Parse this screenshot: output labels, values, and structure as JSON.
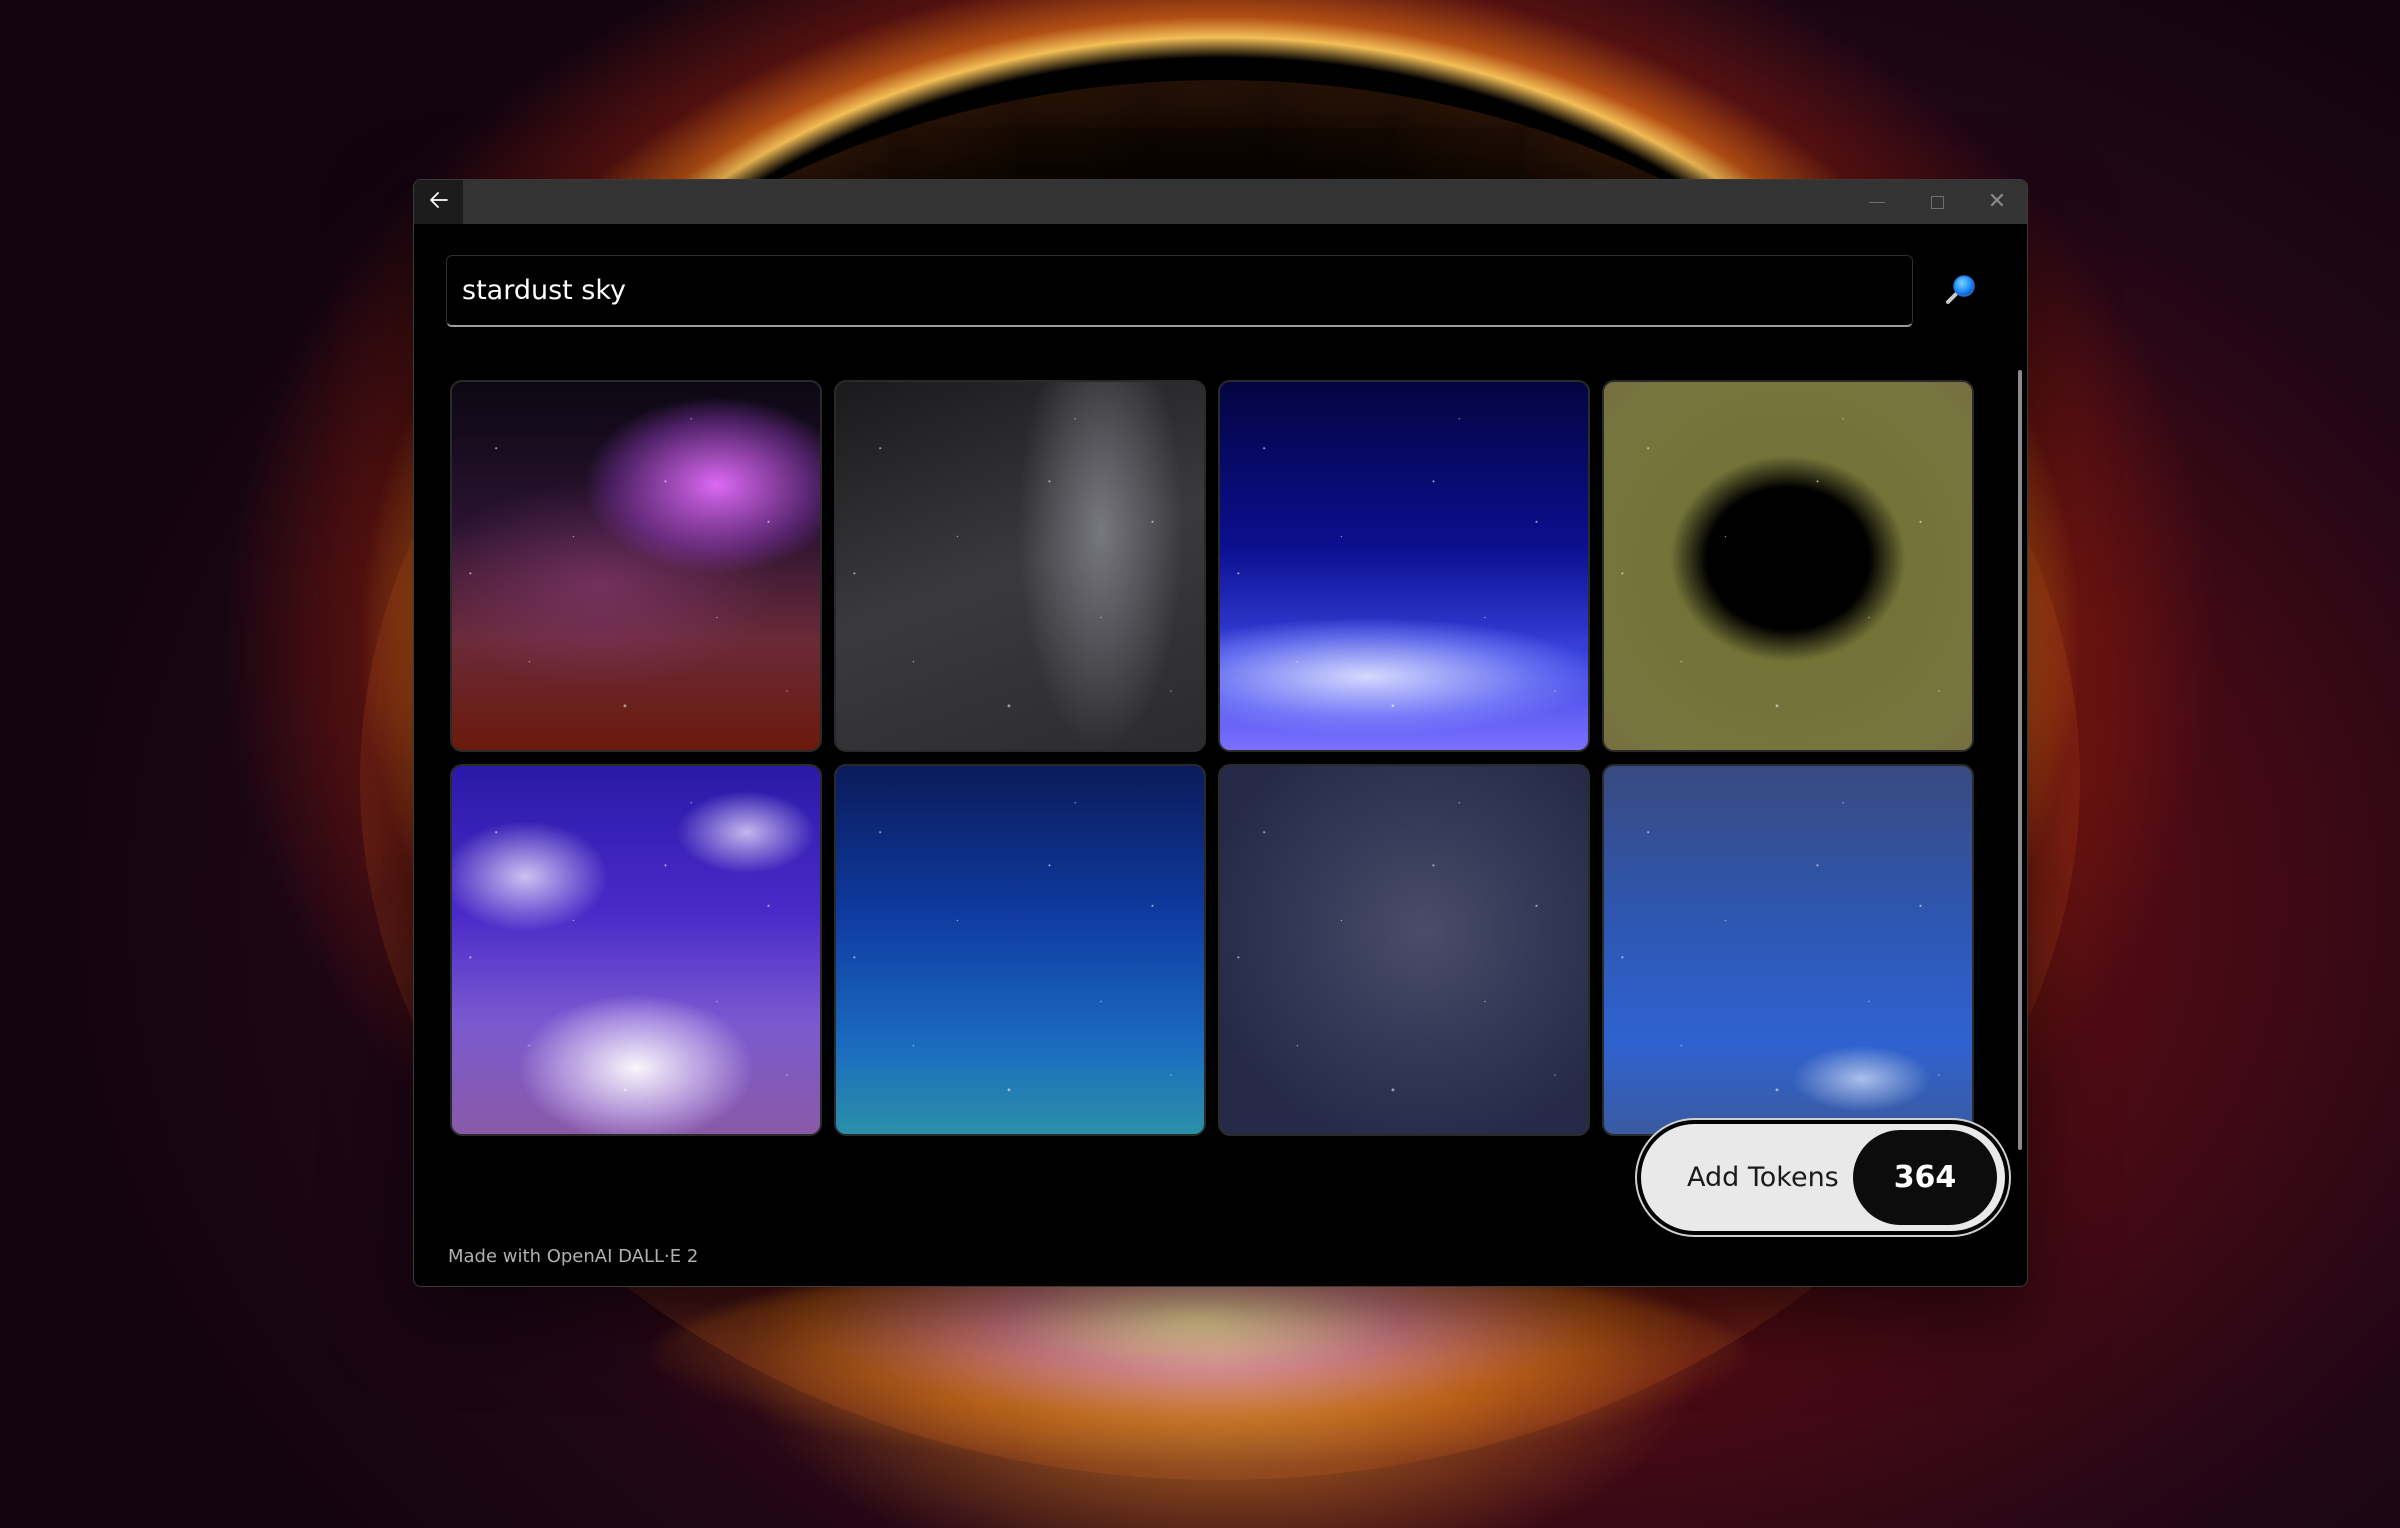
{
  "window": {
    "back_icon": "arrow-left-icon",
    "controls": [
      "minimize-icon",
      "maximize-icon",
      "close-icon"
    ]
  },
  "search": {
    "value": "stardust sky",
    "icon": "search-icon"
  },
  "gallery": {
    "images": [
      "stardust-sky-image-1",
      "stardust-sky-image-2",
      "stardust-sky-image-3",
      "stardust-sky-image-4",
      "stardust-sky-image-5",
      "stardust-sky-image-6",
      "stardust-sky-image-7",
      "stardust-sky-image-8"
    ]
  },
  "tokens": {
    "label": "Add Tokens",
    "count": "364"
  },
  "footer": {
    "credit": "Made with OpenAI DALL·E 2"
  },
  "colors": {
    "accent": "#1E90FF",
    "window_bg": "#000000",
    "titlebar_bg": "#333333"
  }
}
